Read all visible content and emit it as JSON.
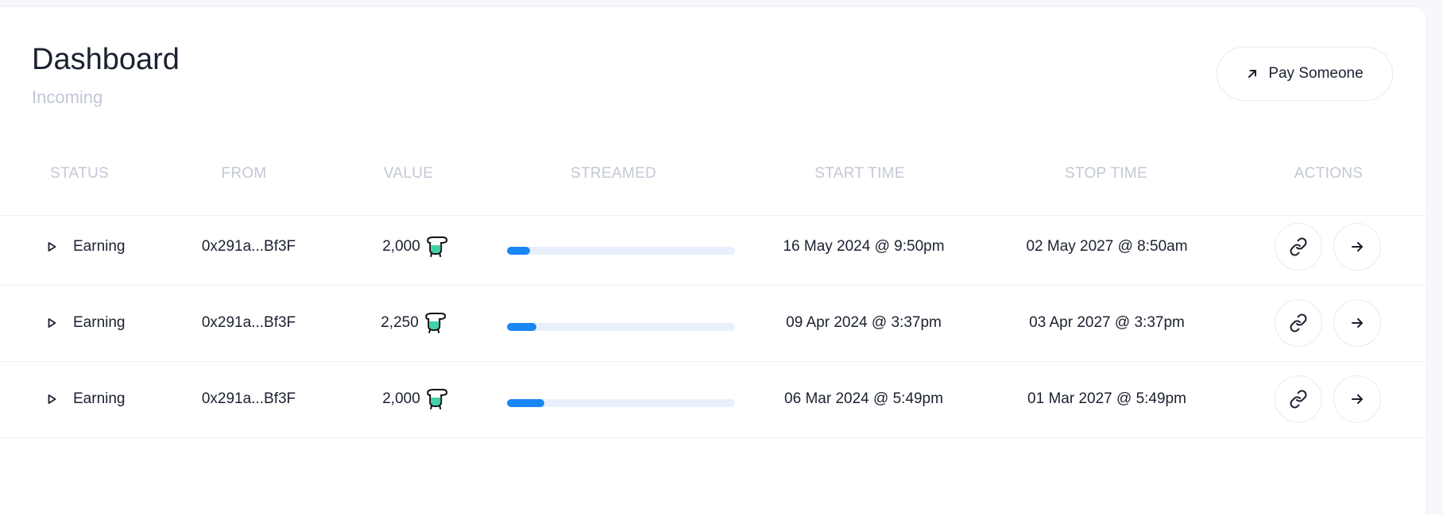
{
  "header": {
    "title": "Dashboard",
    "subtitle": "Incoming",
    "pay_button_label": "Pay Someone"
  },
  "table": {
    "columns": [
      "STATUS",
      "FROM",
      "VALUE",
      "STREAMED",
      "START TIME",
      "STOP TIME",
      "ACTIONS"
    ],
    "rows": [
      {
        "status": "Earning",
        "from": "0x291a...Bf3F",
        "value": "2,000",
        "streamed_fraction": 0.1,
        "start_time": "16 May 2024 @ 9:50pm",
        "stop_time": "02 May 2027 @ 8:50am"
      },
      {
        "status": "Earning",
        "from": "0x291a...Bf3F",
        "value": "2,250",
        "streamed_fraction": 0.13,
        "start_time": "09 Apr 2024 @ 3:37pm",
        "stop_time": "03 Apr 2027 @ 3:37pm"
      },
      {
        "status": "Earning",
        "from": "0x291a...Bf3F",
        "value": "2,000",
        "streamed_fraction": 0.165,
        "start_time": "06 Mar 2024 @ 5:49pm",
        "stop_time": "01 Mar 2027 @ 5:49pm"
      }
    ]
  },
  "icons": {
    "pay": "arrow-up-right-icon",
    "status": "play-icon",
    "token": "token-icon",
    "action_link": "link-icon",
    "action_open": "arrow-right-icon"
  },
  "colors": {
    "accent": "#1a86f4",
    "progress_track": "#e8f0fc",
    "muted_text": "#c3c8d6",
    "token_body": "#3fd0a8"
  }
}
